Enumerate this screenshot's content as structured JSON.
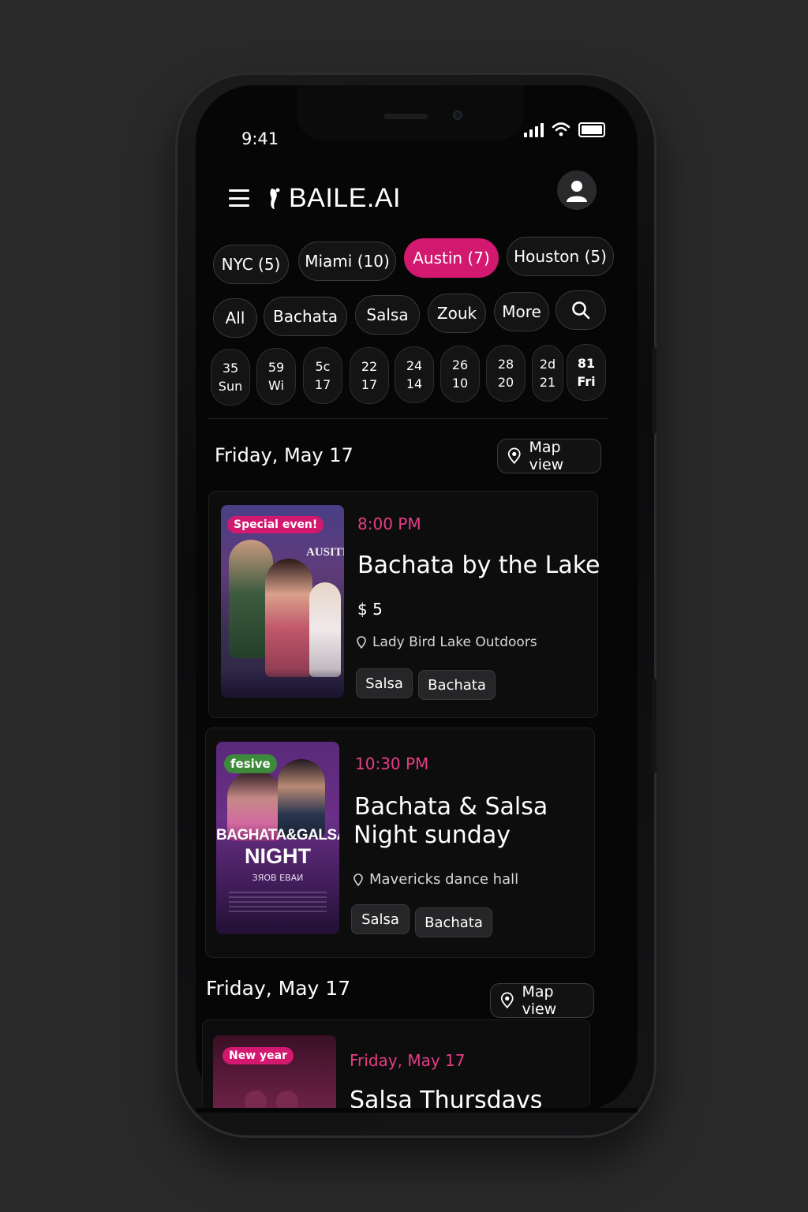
{
  "status": {
    "time": "9:41"
  },
  "header": {
    "app_name": "BAILE.AI",
    "menu_icon": "hamburger-icon",
    "profile_icon": "user-icon"
  },
  "cities": [
    {
      "label": "NYC (5)",
      "active": false
    },
    {
      "label": "Miami (10)",
      "active": false
    },
    {
      "label": "Austin (7)",
      "active": true
    },
    {
      "label": "Houston (5)",
      "active": false
    }
  ],
  "filters": [
    "All",
    "Bachata",
    "Salsa",
    "Zouk",
    "More"
  ],
  "days": [
    {
      "top": "35",
      "bottom": "Sun"
    },
    {
      "top": "59",
      "bottom": "Wi"
    },
    {
      "top": "5c",
      "bottom": "17"
    },
    {
      "top": "22",
      "bottom": "17"
    },
    {
      "top": "24",
      "bottom": "14"
    },
    {
      "top": "26",
      "bottom": "10"
    },
    {
      "top": "28",
      "bottom": "20"
    },
    {
      "top": "2d",
      "bottom": "21"
    },
    {
      "top": "81",
      "bottom": "Fri"
    }
  ],
  "sections": [
    {
      "title": "Friday, May 17",
      "map_label": "Map view"
    },
    {
      "title": "Friday, May 17",
      "map_label": "Map view"
    }
  ],
  "events": [
    {
      "badge": "Special even!",
      "poster_text": "AUSITH",
      "time": "8:00 PM",
      "title": "Bachata by the Lake",
      "price": "$ 5",
      "location": "Lady Bird Lake Outdoors",
      "tags": [
        "Salsa",
        "Bachata"
      ]
    },
    {
      "badge": "fesive",
      "poster_line1": "BAGHATA&GALSA",
      "poster_line2": "NIGHT",
      "poster_line3": "ЗЯОВ ЕВАИ",
      "time": "10:30 PM",
      "title_line1": "Bachata & Salsa",
      "title_line2": "Night sunday",
      "location": "Mavericks dance hall",
      "tags": [
        "Salsa",
        "Bachata"
      ]
    },
    {
      "badge": "New year",
      "time": "Friday, May 17",
      "title": "Salsa Thursdavs"
    }
  ],
  "colors": {
    "accent": "#d3196f",
    "time_pink": "#e63d84",
    "background": "#060606",
    "frame": "#2a2a2b"
  }
}
